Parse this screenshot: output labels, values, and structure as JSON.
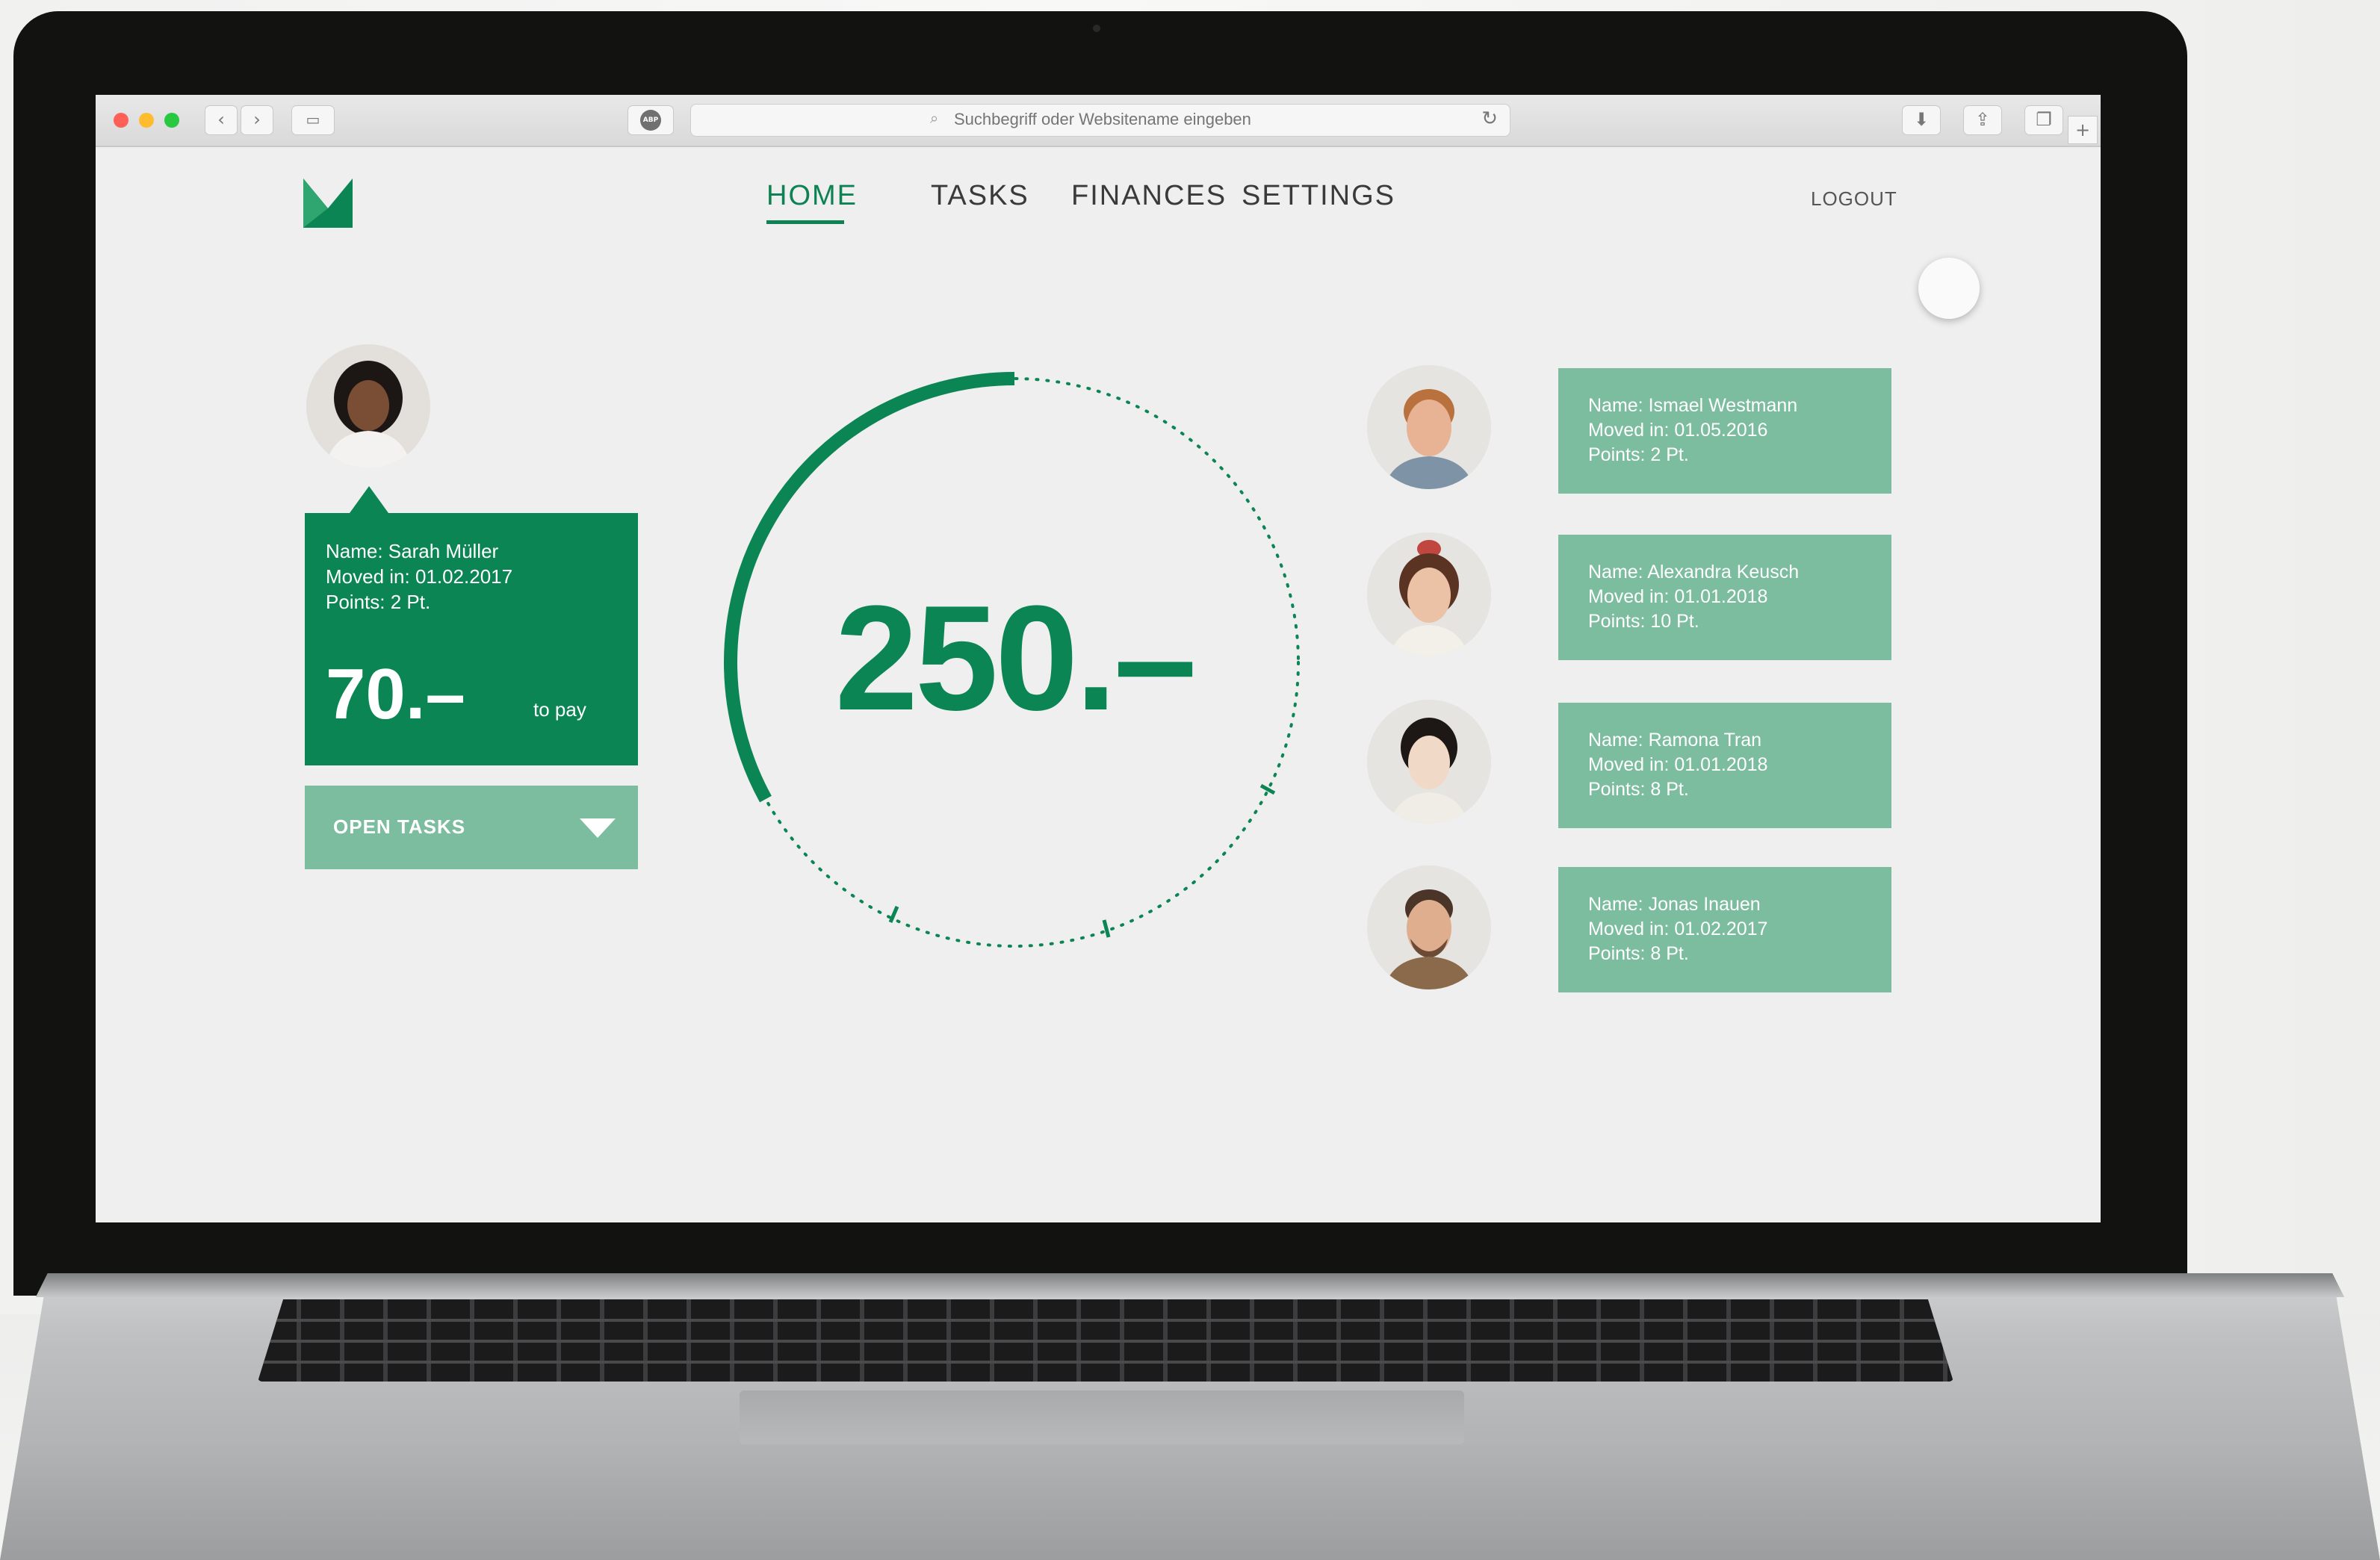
{
  "browser": {
    "address_placeholder": "Suchbegriff oder Websitename eingeben",
    "adblock_label": "ABP",
    "traffic_light_colors": [
      "#fe5f57",
      "#febc2e",
      "#28c840"
    ]
  },
  "nav": {
    "items": [
      {
        "label": "HOME",
        "active": true
      },
      {
        "label": "TASKS",
        "active": false
      },
      {
        "label": "FINANCES",
        "active": false
      },
      {
        "label": "SETTINGS",
        "active": false
      }
    ],
    "logout_label": "LOGOUT"
  },
  "current_user": {
    "name_line": "Name: Sarah Müller",
    "moved_line": "Moved in: 01.02.2017",
    "points_line": "Points: 2 Pt.",
    "amount": "70.–",
    "amount_caption": "to pay",
    "open_tasks_label": "OPEN TASKS"
  },
  "total": {
    "amount": "250.–",
    "progress_fraction": 0.33
  },
  "roommates": [
    {
      "name_line": "Name: Ismael Westmann",
      "moved_line": "Moved in: 01.05.2016",
      "points_line": "Points: 2 Pt."
    },
    {
      "name_line": "Name: Alexandra Keusch",
      "moved_line": "Moved in: 01.01.2018",
      "points_line": "Points: 10 Pt."
    },
    {
      "name_line": "Name: Ramona Tran",
      "moved_line": "Moved in: 01.01.2018",
      "points_line": "Points: 8 Pt."
    },
    {
      "name_line": "Name: Jonas Inauen",
      "moved_line": "Moved in: 01.02.2017",
      "points_line": "Points: 8 Pt."
    }
  ],
  "colors": {
    "brand_green": "#0b8553",
    "light_green": "#7dbd9f",
    "background": "#efefef"
  }
}
